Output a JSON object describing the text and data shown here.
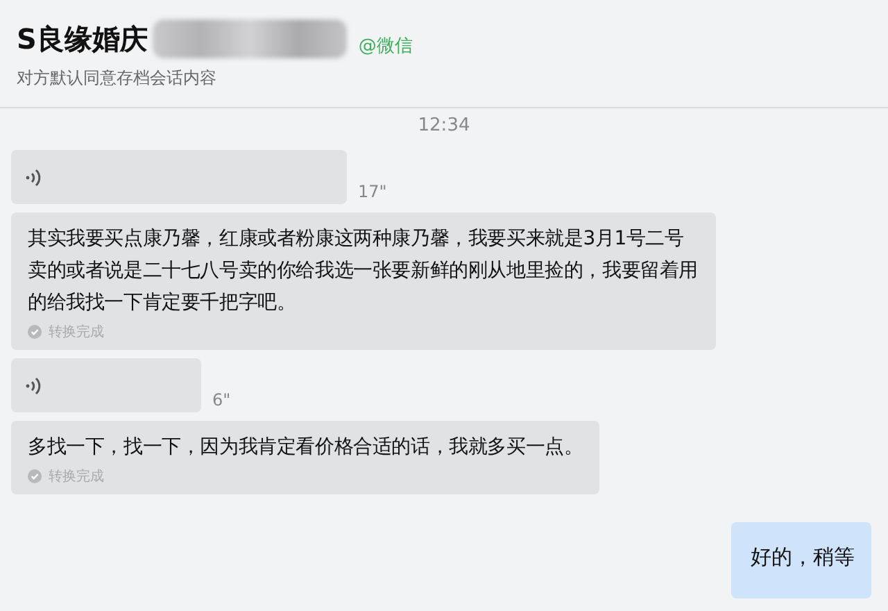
{
  "chat": {
    "title": "S良缘婚庆",
    "source": "@微信",
    "subtitle": "对方默认同意存档会话内容"
  },
  "time": "12:34",
  "messages": [
    {
      "kind": "voice",
      "outgoing": false,
      "duration": "17\""
    },
    {
      "kind": "transcript",
      "outgoing": false,
      "text": "其实我要买点康乃馨，红康或者粉康这两种康乃馨，我要买来就是3月1号二号卖的或者说是二十七八号卖的你给我选一张要新鲜的刚从地里捡的，我要留着用的给我找一下肯定要千把字吧。",
      "status": "转换完成"
    },
    {
      "kind": "voice",
      "outgoing": false,
      "duration": "6\""
    },
    {
      "kind": "transcript",
      "outgoing": false,
      "text": "多找一下，找一下，因为我肯定看价格合适的话，我就多买一点。",
      "status": "转换完成"
    },
    {
      "kind": "text",
      "outgoing": true,
      "text": "好的，稍等"
    }
  ]
}
